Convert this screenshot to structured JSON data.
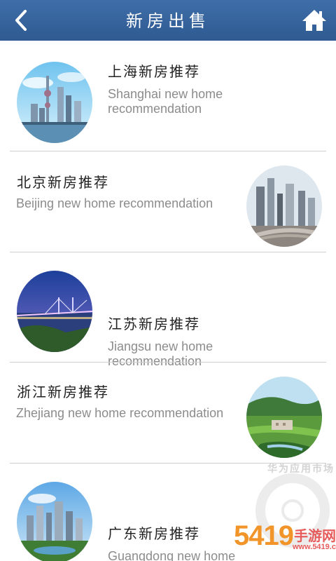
{
  "header": {
    "title": "新房出售",
    "back_icon": "back-arrow-icon",
    "home_icon": "home-icon",
    "background": "#3a659e"
  },
  "items": [
    {
      "zh": "上海新房推荐",
      "en": "Shanghai new home recommendation",
      "image": "shanghai-skyline"
    },
    {
      "zh": "北京新房推荐",
      "en": "Beijing new home recommendation",
      "image": "beijing-skyline"
    },
    {
      "zh": "江苏新房推荐",
      "en": "Jiangsu new home recommendation",
      "image": "jiangsu-bridge"
    },
    {
      "zh": "浙江新房推荐",
      "en": "Zhejiang new home recommendation",
      "image": "zhejiang-village"
    },
    {
      "zh": "广东新房推荐",
      "en": "Guangdong new home recommendation",
      "image": "guangdong-city"
    }
  ],
  "watermark": {
    "arc_text": "华为应用市场",
    "brand_number": "5419",
    "brand_text": "手游网",
    "url": "www.5419.cn"
  }
}
